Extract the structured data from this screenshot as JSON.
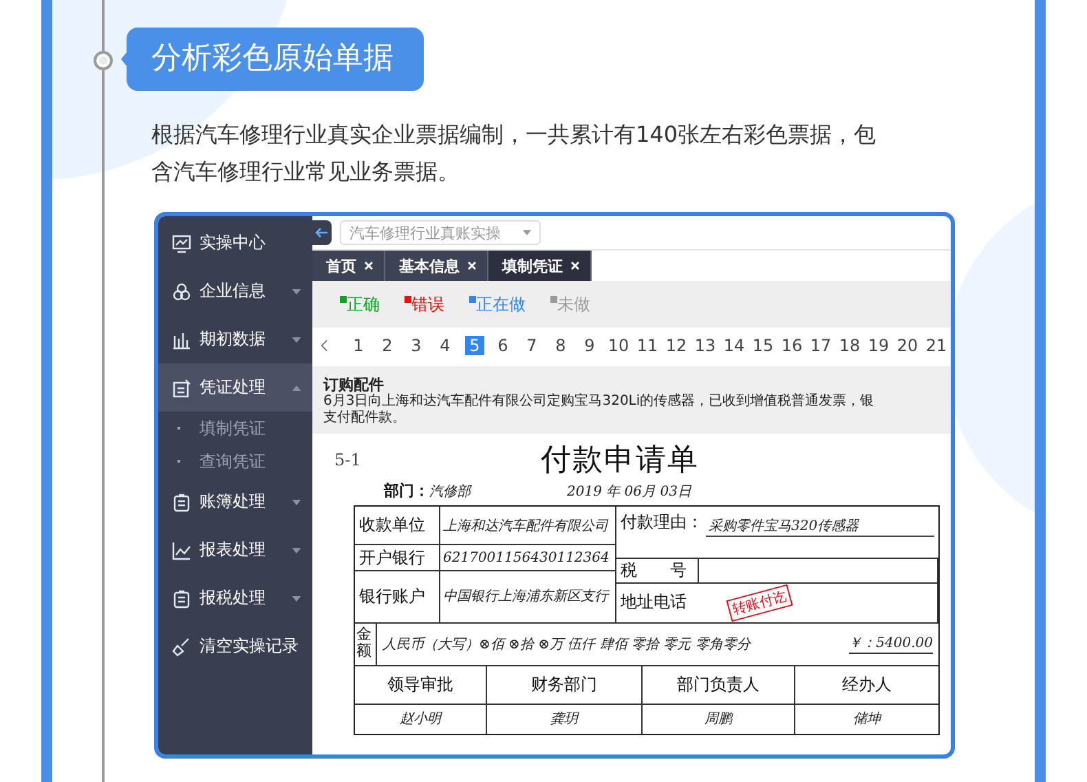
{
  "heading": "分析彩色原始单据",
  "intro": "根据汽车修理行业真实企业票据编制，一共累计有140张左右彩色票据，包含汽车修理行业常见业务票据。",
  "app": {
    "sidebar": [
      {
        "label": "实操中心",
        "selected": false
      },
      {
        "label": "企业信息",
        "selected": false,
        "expanded": false
      },
      {
        "label": "期初数据",
        "selected": false,
        "expanded": false
      },
      {
        "label": "凭证处理",
        "selected": true,
        "expanded": true,
        "children": [
          {
            "label": "填制凭证",
            "selected": false
          },
          {
            "label": "查询凭证",
            "selected": false
          }
        ]
      },
      {
        "label": "账簿处理",
        "selected": false,
        "expanded": false
      },
      {
        "label": "报表处理",
        "selected": false,
        "expanded": false
      },
      {
        "label": "报税处理",
        "selected": false,
        "expanded": false
      },
      {
        "label": "清空实操记录",
        "selected": false
      }
    ],
    "book_dropdown": "汽车修理行业真账实操",
    "tabs": [
      {
        "label": "首页",
        "selected": false
      },
      {
        "label": "基本信息",
        "selected": false
      },
      {
        "label": "填制凭证",
        "selected": true
      }
    ],
    "legend": [
      {
        "label": "正确",
        "color": "#0aa51c"
      },
      {
        "label": "错误",
        "color": "#f20d0d"
      },
      {
        "label": "正在做",
        "color": "#2f86f0"
      },
      {
        "label": "未做",
        "color": "#9a9a9a"
      }
    ],
    "pages": [
      {
        "label": "1",
        "selected": false
      },
      {
        "label": "2",
        "selected": false
      },
      {
        "label": "3",
        "selected": false
      },
      {
        "label": "4",
        "selected": false
      },
      {
        "label": "5",
        "selected": true
      },
      {
        "label": "6",
        "selected": false
      },
      {
        "label": "7",
        "selected": false
      },
      {
        "label": "8",
        "selected": false
      },
      {
        "label": "9",
        "selected": false
      },
      {
        "label": "10",
        "selected": false
      },
      {
        "label": "11",
        "selected": false
      },
      {
        "label": "12",
        "selected": false
      },
      {
        "label": "13",
        "selected": false
      },
      {
        "label": "14",
        "selected": false
      },
      {
        "label": "15",
        "selected": false
      },
      {
        "label": "16",
        "selected": false
      },
      {
        "label": "17",
        "selected": false
      },
      {
        "label": "18",
        "selected": false
      },
      {
        "label": "19",
        "selected": false
      },
      {
        "label": "20",
        "selected": false
      },
      {
        "label": "21",
        "selected": false
      }
    ],
    "task": {
      "title": "订购配件",
      "lines": [
        "6月3日向上海和达汽车配件有限公司定购宝马320Li的传感器，已收到增值税普通发票，银",
        "支付配件款。"
      ]
    },
    "voucher": {
      "number": "5-1",
      "title": "付款申请单",
      "department_label": "部门：",
      "department": "汽修部",
      "date": "2019 年 06月 03日",
      "payee_label": "收款单位",
      "payee": "上海和达汽车配件有限公司",
      "bank_label": "开户银行",
      "bank": "6217001156430112364",
      "account_label": "银行账户",
      "account": "中国银行上海浦东新区支行",
      "reason_label": "付款理由：",
      "reason": "采购零件宝马320传感器",
      "tax_label": "税　　号",
      "address_label": "地址电话",
      "stamp": "转账付讫",
      "amount_label": "金额",
      "amount_words": "人民币（大写）⊗佰 ⊗拾 ⊗万 伍仟 肆佰 零拾 零元 零角零分",
      "amount": "￥：5400.00",
      "signatures": [
        {
          "role": "领导审批",
          "name": "赵小明"
        },
        {
          "role": "财务部门",
          "name": "龚玥"
        },
        {
          "role": "部门负责人",
          "name": "周鹏"
        },
        {
          "role": "经办人",
          "name": "储坤"
        }
      ]
    }
  }
}
